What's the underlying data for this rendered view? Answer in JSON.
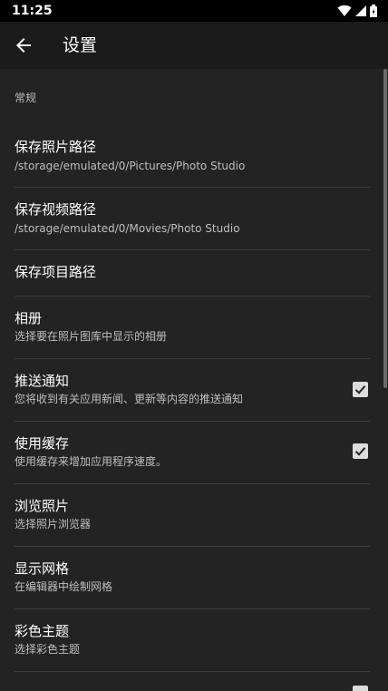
{
  "status_bar": {
    "time": "11:25"
  },
  "app_bar": {
    "title": "设置",
    "back_icon": "arrow-left-icon"
  },
  "section": {
    "header": "常规"
  },
  "items": [
    {
      "title": "保存照片路径",
      "summary": "/storage/emulated/0/Pictures/Photo Studio"
    },
    {
      "title": "保存视频路径",
      "summary": "/storage/emulated/0/Movies/Photo Studio"
    },
    {
      "title": "保存项目路径",
      "summary": ""
    },
    {
      "title": "相册",
      "summary": "选择要在照片图库中显示的相册"
    },
    {
      "title": "推送通知",
      "summary": "您将收到有关应用新闻、更新等内容的推送通知",
      "checked": true
    },
    {
      "title": "使用缓存",
      "summary": "使用缓存来增加应用程序速度。",
      "checked": true
    },
    {
      "title": "浏览照片",
      "summary": "选择照片浏览器"
    },
    {
      "title": "显示网格",
      "summary": "在编辑器中绘制网格"
    },
    {
      "title": "彩色主题",
      "summary": "选择彩色主题"
    }
  ],
  "colors": {
    "background": "#232323",
    "app_bar": "#1b1b1b",
    "status_bar": "#000000",
    "checkbox": "#dcdcdc"
  }
}
